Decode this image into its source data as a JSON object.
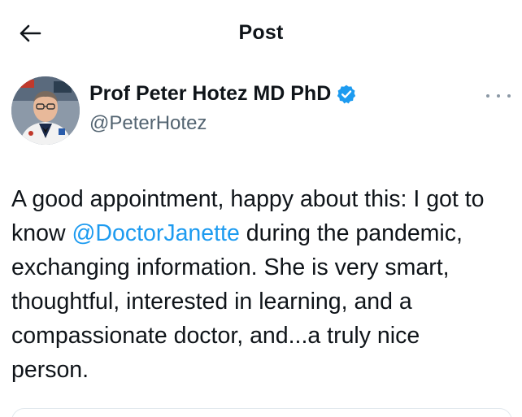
{
  "header": {
    "back_icon": "back-arrow-icon",
    "title": "Post"
  },
  "author": {
    "display_name": "Prof Peter Hotez MD PhD",
    "handle": "@PeterHotez",
    "verified": true,
    "verified_color": "#1d9bf0"
  },
  "post": {
    "text_before_mention": "A good appointment, happy about this: I got to know ",
    "mention": "@DoctorJanette",
    "text_after_mention": " during the pandemic, exchanging information. She is very smart, thoughtful, interested in learning, and a compassionate doctor, and...a truly nice person."
  },
  "colors": {
    "text": "#0f1419",
    "secondary": "#536471",
    "link": "#1d9bf0"
  }
}
